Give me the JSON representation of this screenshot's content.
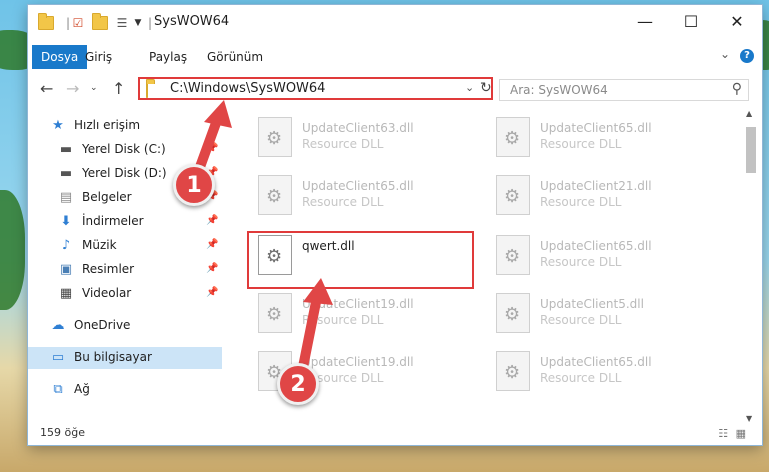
{
  "window": {
    "title": "SysWOW64"
  },
  "ribbon": {
    "tabs": [
      "Dosya",
      "Giriş",
      "Paylaş",
      "Görünüm"
    ],
    "help": "?"
  },
  "address": {
    "path": "C:\\Windows\\SysWOW64"
  },
  "search": {
    "placeholder": "Ara: SysWOW64"
  },
  "sidebar": {
    "items": [
      {
        "label": "Hızlı erişim",
        "icon": "star-icon"
      },
      {
        "label": "Yerel Disk (C:)",
        "icon": "drive-icon"
      },
      {
        "label": "Yerel Disk (D:)",
        "icon": "drive-icon"
      },
      {
        "label": "Belgeler",
        "icon": "documents-icon"
      },
      {
        "label": "İndirmeler",
        "icon": "download-icon"
      },
      {
        "label": "Müzik",
        "icon": "music-icon"
      },
      {
        "label": "Resimler",
        "icon": "pictures-icon"
      },
      {
        "label": "Videolar",
        "icon": "videos-icon"
      },
      {
        "label": "OneDrive",
        "icon": "cloud-icon"
      },
      {
        "label": "Bu bilgisayar",
        "icon": "computer-icon"
      },
      {
        "label": "Ağ",
        "icon": "network-icon"
      }
    ]
  },
  "files": [
    {
      "name": "UpdateClient63.dll",
      "type": "Resource DLL"
    },
    {
      "name": "UpdateClient65.dll",
      "type": "Resource DLL"
    },
    {
      "name": "UpdateClient65.dll",
      "type": "Resource DLL"
    },
    {
      "name": "UpdateClient21.dll",
      "type": "Resource DLL"
    },
    {
      "name": "qwert.dll",
      "type": ""
    },
    {
      "name": "UpdateClient65.dll",
      "type": "Resource DLL"
    },
    {
      "name": "UpdateClient19.dll",
      "type": "Resource DLL"
    },
    {
      "name": "UpdateClient5.dll",
      "type": "Resource DLL"
    },
    {
      "name": "UpdateClient19.dll",
      "type": "Resource DLL"
    },
    {
      "name": "UpdateClient65.dll",
      "type": "Resource DLL"
    }
  ],
  "status": {
    "count": "159 öğe"
  },
  "annotations": {
    "step1": "1",
    "step2": "2",
    "color": "#e04646"
  }
}
